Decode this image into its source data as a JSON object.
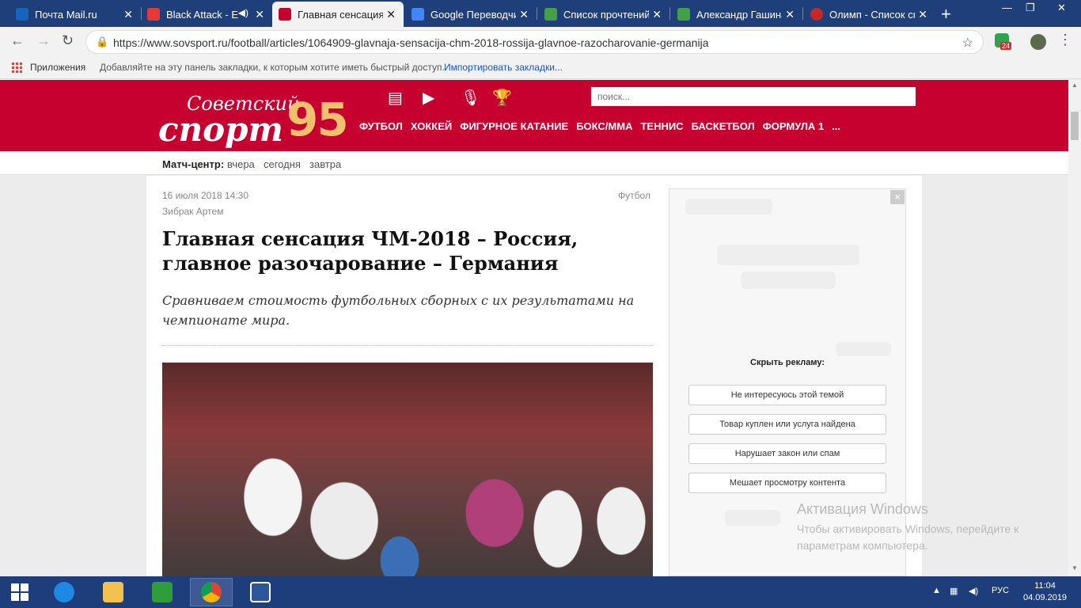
{
  "browser": {
    "tabs": [
      {
        "title": "Почта Mail.ru",
        "favicon_color": "#1565c0"
      },
      {
        "title": "Black Attack - E",
        "favicon_color": "#e53935"
      },
      {
        "title": "Главная сенсация",
        "favicon_color": "#c6002f"
      },
      {
        "title": "Google Переводчи",
        "favicon_color": "#4285f4"
      },
      {
        "title": "Список прочтений",
        "favicon_color": "#43a047"
      },
      {
        "title": "Александр Гашина",
        "favicon_color": "#43a047"
      },
      {
        "title": "Олимп - Список сп",
        "favicon_color": "#c62828"
      }
    ],
    "active_tab": 2,
    "url": "https://www.sovsport.ru/football/articles/1064909-glavnaja-sensacija-chm-2018-rossija-glavnoe-razocharovanie-germanija",
    "ext_badge": "24",
    "bookmarks": {
      "apps": "Приложения",
      "hint": "Добавляйте на эту панель закладки, к которым хотите иметь быстрый доступ.",
      "import": "Импортировать закладки..."
    }
  },
  "site": {
    "logo_line1": "Советский",
    "logo_line2": "спорт",
    "logo_number": "95",
    "brand_color": "#c6002f",
    "nav": [
      "ФУТБОЛ",
      "ХОККЕЙ",
      "ФИГУРНОЕ КАТАНИЕ",
      "БОКС/ММА",
      "ТЕННИС",
      "БАСКЕТБОЛ",
      "ФОРМУЛА 1",
      "..."
    ],
    "header_icons": [
      "news-icon",
      "video-icon",
      "microphone-icon",
      "trophy-icon"
    ],
    "search_placeholder": "поиск...",
    "match_center": {
      "label": "Матч-центр:",
      "links": [
        "вчера",
        "сегодня",
        "завтра"
      ]
    }
  },
  "article": {
    "date": "16 июля 2018 14:30",
    "author": "Зибрак Артем",
    "category": "Футбол",
    "headline": "Главная сенсация ЧМ-2018 – Россия, главное разочарование – Германия",
    "lead": "Сравниваем стоимость футбольных сборных с их результатами на чемпионате мира."
  },
  "ad": {
    "close": "×",
    "hide_title": "Скрыть рекламу:",
    "options": [
      "Не интересуюсь этой темой",
      "Товар куплен или услуга найдена",
      "Нарушает закон или спам",
      "Мешает просмотру контента"
    ]
  },
  "watermark": {
    "title": "Активация Windows",
    "line1": "Чтобы активировать Windows, перейдите к",
    "line2": "параметрам компьютера."
  },
  "taskbar": {
    "lang": "РУС",
    "time": "11:04",
    "date": "04.09.2019"
  }
}
